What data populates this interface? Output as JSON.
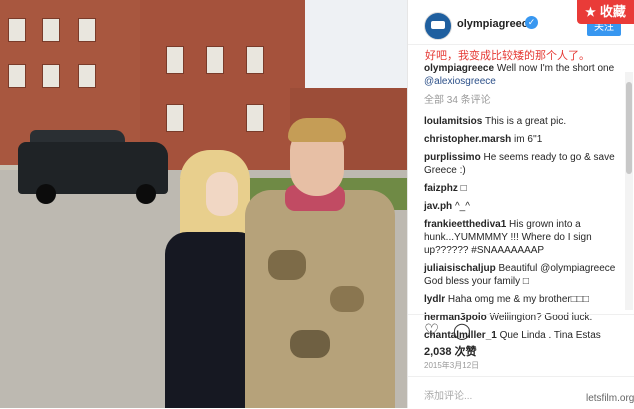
{
  "post": {
    "username": "olympiagreece",
    "follow_label": "关注",
    "caption_cn": "好吧，我变成比较矮的那个人了。",
    "caption_author": "olympiagreece",
    "caption_text": "Well now I'm the short one",
    "caption_mention": "@alexiosgreece",
    "view_all_comments": "全部 34 条评论",
    "comments": [
      {
        "user": "loulamitsios",
        "text": "This is a great pic."
      },
      {
        "user": "christopher.marsh",
        "text": "im 6''1"
      },
      {
        "user": "purplissimo",
        "text": "He seems ready to go & save Greece :)"
      },
      {
        "user": "faizphz",
        "text": "□"
      },
      {
        "user": "jav.ph",
        "text": "^_^"
      },
      {
        "user": "frankieetthediva1",
        "text": "His grown into a hunk...YUMMMMY !!! Where do I sign up?????? #SNAAAAAAAP"
      },
      {
        "user": "juliaisischaljup",
        "text": "Beautiful @olympiagreece God bless your family □"
      },
      {
        "user": "lydlr",
        "text": "Haha omg me & my brother□□□"
      },
      {
        "user": "herman3polo",
        "text": "Wellington? Good luck."
      },
      {
        "user": "chantalmiller_1",
        "text": "Que Linda . Tina Estas"
      }
    ],
    "likes": "2,038 次赞",
    "date": "2015年3月12日",
    "add_comment_placeholder": "添加评论..."
  },
  "overlay": {
    "collect_label": "收藏",
    "watermark": "letsfilm.org"
  },
  "icons": {
    "heart": "heart-icon",
    "comment": "comment-icon",
    "verified": "verified-badge-icon"
  },
  "colors": {
    "accent": "#3897f0",
    "collect": "#e93b38",
    "caption_cn": "#e53a35"
  }
}
